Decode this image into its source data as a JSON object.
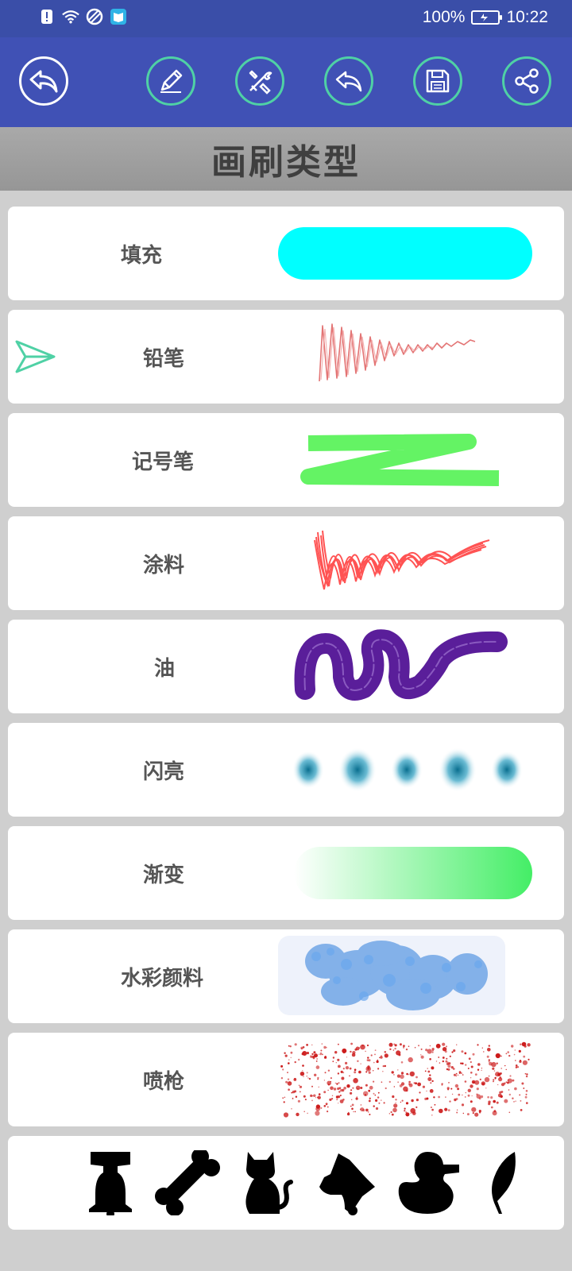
{
  "status": {
    "battery": "100%",
    "time": "10:22"
  },
  "toolbar": {
    "back_icon": "back-arrow-icon",
    "buttons": [
      "pencil-icon",
      "tools-icon",
      "undo-icon",
      "save-icon",
      "share-icon"
    ],
    "accent": "#4fd1a5",
    "background": "#4051b5"
  },
  "header": {
    "title": "画刷类型"
  },
  "brushes": [
    {
      "label": "填充",
      "preview": "fill",
      "color": "#00ffff"
    },
    {
      "label": "铅笔",
      "preview": "pencil",
      "color": "#e07070",
      "selected": true
    },
    {
      "label": "记号笔",
      "preview": "marker",
      "color": "#33ee33"
    },
    {
      "label": "涂料",
      "preview": "paint",
      "color": "#ff2020"
    },
    {
      "label": "油",
      "preview": "oil",
      "color": "#5a1e9a"
    },
    {
      "label": "闪亮",
      "preview": "glow",
      "color": "#0a7e9e"
    },
    {
      "label": "渐变",
      "preview": "gradient",
      "color": "#55ee77"
    },
    {
      "label": "水彩颜料",
      "preview": "watercolor",
      "color": "#5599e0"
    },
    {
      "label": "喷枪",
      "preview": "airbrush",
      "color": "#cc1a1a"
    }
  ],
  "stamps": [
    "bell-icon",
    "bone-icon",
    "cat-icon",
    "dog-icon",
    "duck-icon",
    "feather-icon"
  ]
}
